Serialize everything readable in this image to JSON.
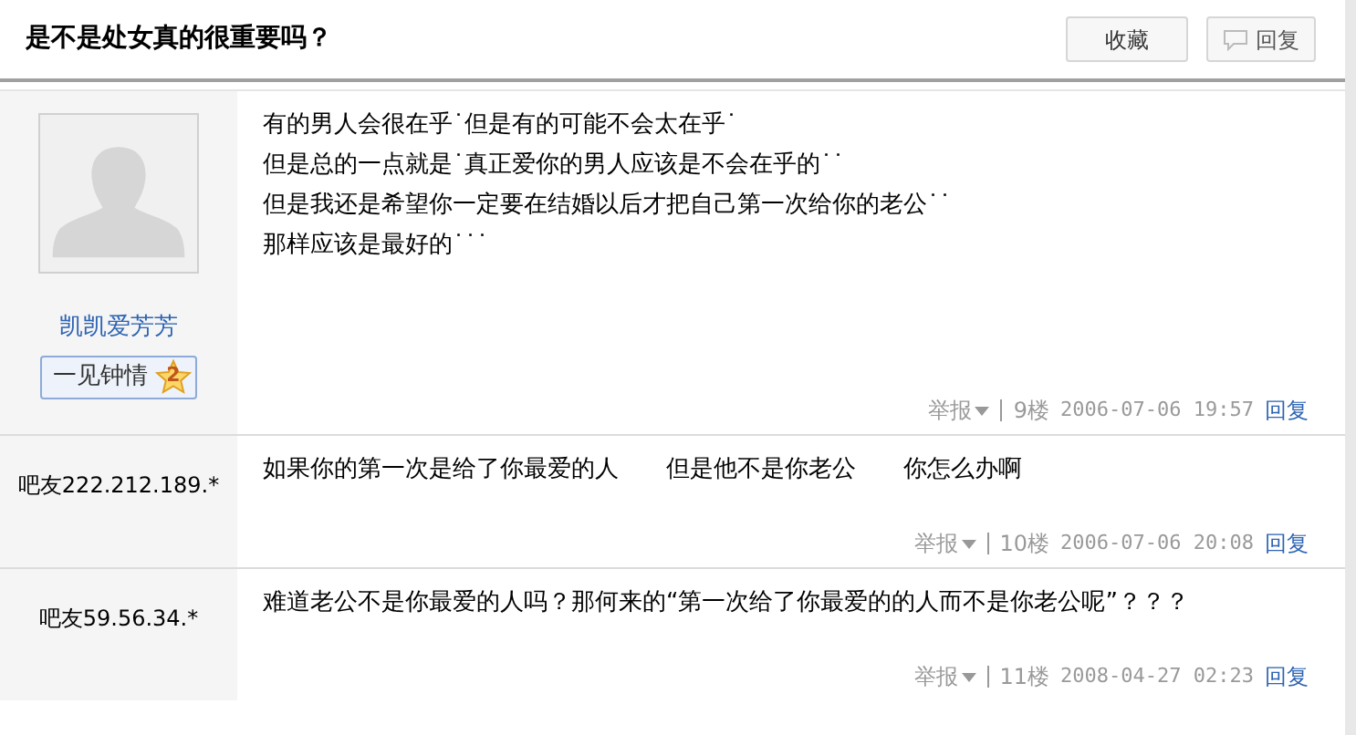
{
  "header": {
    "title": "是不是处女真的很重要吗？",
    "buttons": [
      {
        "label": "收藏",
        "kind": "plain"
      },
      {
        "label": "回复",
        "kind": "reply"
      }
    ]
  },
  "posts": [
    {
      "author": {
        "kind": "member",
        "name": "凯凯爱芳芳",
        "badge": "一见钟情",
        "badge_level": "2"
      },
      "lines": [
        "有的男人会很在乎˙但是有的可能不会太在乎˙",
        "但是总的一点就是˙真正爱你的男人应该是不会在乎的˙˙",
        "但是我还是希望你一定要在结婚以后才把自己第一次给你的老公˙˙",
        "那样应该是最好的˙˙˙"
      ],
      "report": "举报",
      "floor": "9楼",
      "time": "2006-07-06 19:57",
      "reply": "回复"
    },
    {
      "author": {
        "kind": "guest",
        "name": "吧友222.212.189.*"
      },
      "lines": [
        "如果你的第一次是给了你最爱的人　　但是他不是你老公　　你怎么办啊"
      ],
      "report": "举报",
      "floor": "10楼",
      "time": "2006-07-06 20:08",
      "reply": "回复"
    },
    {
      "author": {
        "kind": "guest",
        "name": "吧友59.56.34.*"
      },
      "lines": [
        "难道老公不是你最爱的人吗？那何来的“第一次给了你最爱的的人而不是你老公呢”？？？"
      ],
      "report": "举报",
      "floor": "11楼",
      "time": "2008-04-27 02:23",
      "reply": "回复"
    }
  ]
}
